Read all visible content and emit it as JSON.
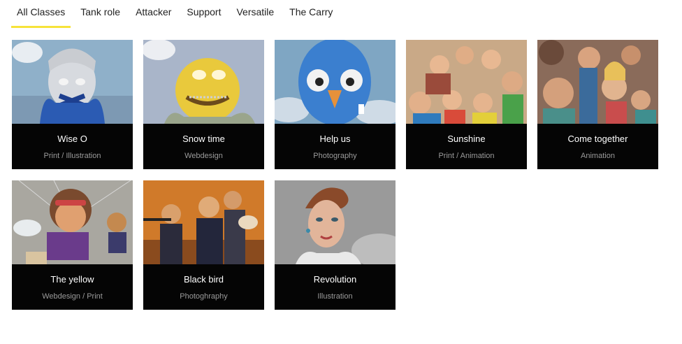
{
  "filters": [
    {
      "label": "All Classes",
      "active": true
    },
    {
      "label": "Tank role",
      "active": false
    },
    {
      "label": "Attacker",
      "active": false
    },
    {
      "label": "Support",
      "active": false
    },
    {
      "label": "Versatile",
      "active": false
    },
    {
      "label": "The Carry",
      "active": false
    }
  ],
  "colors": {
    "accent": "#f6e33a",
    "card_bg": "#050505",
    "subtitle": "#9b9b9b"
  },
  "portfolio": [
    {
      "title": "Wise O",
      "category": "Print / Illustration"
    },
    {
      "title": "Snow time",
      "category": "Webdesign"
    },
    {
      "title": "Help us",
      "category": "Photography"
    },
    {
      "title": "Sunshine",
      "category": "Print / Animation"
    },
    {
      "title": "Come together",
      "category": "Animation"
    },
    {
      "title": "The yellow",
      "category": "Webdesign / Print"
    },
    {
      "title": "Black bird",
      "category": "Photoghraphy"
    },
    {
      "title": "Revolution",
      "category": "Illustration"
    }
  ]
}
